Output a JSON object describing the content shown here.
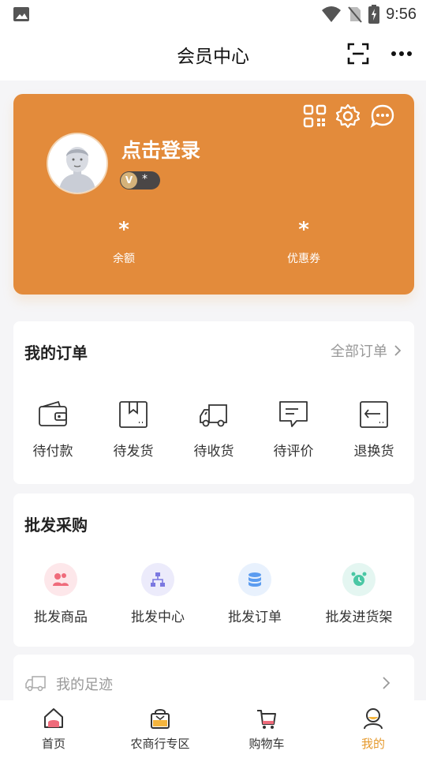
{
  "status_bar": {
    "time": "9:56"
  },
  "header": {
    "title": "会员中心"
  },
  "member_card": {
    "login_text": "点击登录",
    "level_value": "*",
    "stats": [
      {
        "value": "*",
        "label": "余额"
      },
      {
        "value": "*",
        "label": "优惠券"
      }
    ],
    "accent_color": "#e38b3b"
  },
  "orders": {
    "title": "我的订单",
    "all_label": "全部订单",
    "items": [
      {
        "label": "待付款",
        "icon": "wallet-icon"
      },
      {
        "label": "待发货",
        "icon": "package-icon"
      },
      {
        "label": "待收货",
        "icon": "truck-icon"
      },
      {
        "label": "待评价",
        "icon": "comment-icon"
      },
      {
        "label": "退换货",
        "icon": "return-icon"
      }
    ]
  },
  "wholesale": {
    "title": "批发采购",
    "items": [
      {
        "label": "批发商品",
        "icon": "goods-icon"
      },
      {
        "label": "批发中心",
        "icon": "org-chart-icon"
      },
      {
        "label": "批发订单",
        "icon": "database-icon"
      },
      {
        "label": "批发进货架",
        "icon": "alarm-clock-icon"
      }
    ]
  },
  "footprint": {
    "label": "我的足迹"
  },
  "tabbar": {
    "items": [
      {
        "label": "首页",
        "icon": "home-icon"
      },
      {
        "label": "农商行专区",
        "icon": "bank-bag-icon"
      },
      {
        "label": "购物车",
        "icon": "cart-icon"
      },
      {
        "label": "我的",
        "icon": "user-icon",
        "active": true
      }
    ],
    "active_color": "#e59a2e"
  }
}
